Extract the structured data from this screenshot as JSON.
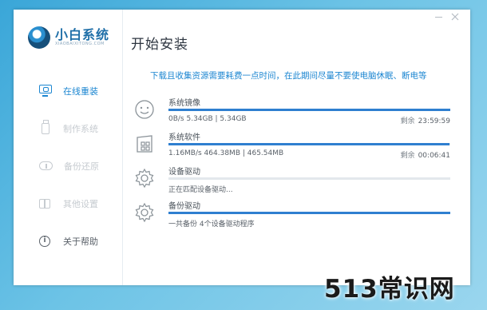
{
  "app": {
    "brand_name": "小白系统",
    "brand_sub": "XIAOBAIXITONG.COM",
    "window_title": "开始安装"
  },
  "sidebar": {
    "items": [
      {
        "label": "在线重装",
        "icon": "monitor-icon",
        "state": "active"
      },
      {
        "label": "制作系统",
        "icon": "usb-drive-icon",
        "state": "dim"
      },
      {
        "label": "备份还原",
        "icon": "cloud-backup-icon",
        "state": "dim"
      },
      {
        "label": "其他设置",
        "icon": "grid-settings-icon",
        "state": "dim"
      },
      {
        "label": "关于帮助",
        "icon": "info-icon",
        "state": "normal"
      }
    ]
  },
  "notice": "下载且收集资源需要耗费一点时间，在此期间尽量不要使电脑休眠、断电等",
  "tasks": [
    {
      "name": "系统镜像",
      "icon": "smiley-icon",
      "detail": "0B/s 5.34GB | 5.34GB",
      "remaining_label": "剩余",
      "remaining": "23:59:59",
      "progress": 1.0
    },
    {
      "name": "系统软件",
      "icon": "apps-icon",
      "detail": "1.16MB/s 464.38MB | 465.54MB",
      "remaining_label": "剩余",
      "remaining": "00:06:41",
      "progress": 0.998
    },
    {
      "name": "设备驱动",
      "icon": "gear-icon",
      "detail": "正在匹配设备驱动...",
      "remaining_label": "",
      "remaining": "",
      "progress": 0.0
    },
    {
      "name": "备份驱动",
      "icon": "gear-icon",
      "detail": "一共备份 4个设备驱动程序",
      "remaining_label": "",
      "remaining": "",
      "progress": 1.0
    }
  ],
  "colors": {
    "accent": "#1c86d1",
    "progress": "#2f7fd0",
    "track": "#e3e8ec"
  },
  "watermark": "513常识网"
}
